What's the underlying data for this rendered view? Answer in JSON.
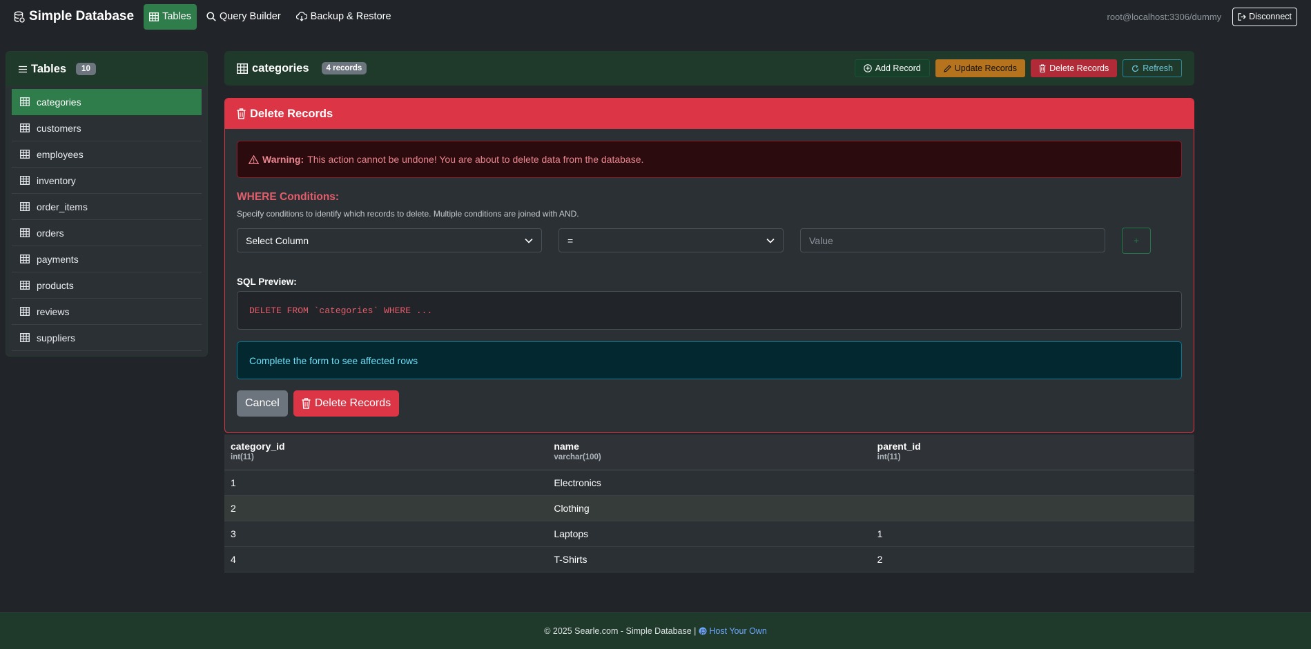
{
  "navbar": {
    "brand": "Simple Database",
    "links": [
      {
        "label": "Tables",
        "icon": "table-icon",
        "active": true
      },
      {
        "label": "Query Builder",
        "icon": "search-icon",
        "active": false
      },
      {
        "label": "Backup & Restore",
        "icon": "cloud-download-icon",
        "active": false
      }
    ],
    "connection": "root@localhost:3306/dummy",
    "disconnect_label": "Disconnect"
  },
  "sidebar": {
    "title": "Tables",
    "count": "10",
    "items": [
      {
        "label": "categories",
        "active": true
      },
      {
        "label": "customers",
        "active": false
      },
      {
        "label": "employees",
        "active": false
      },
      {
        "label": "inventory",
        "active": false
      },
      {
        "label": "order_items",
        "active": false
      },
      {
        "label": "orders",
        "active": false
      },
      {
        "label": "payments",
        "active": false
      },
      {
        "label": "products",
        "active": false
      },
      {
        "label": "reviews",
        "active": false
      },
      {
        "label": "suppliers",
        "active": false
      }
    ]
  },
  "table_header": {
    "name": "categories",
    "records": "4 records",
    "actions": {
      "add": "Add Record",
      "update": "Update Records",
      "delete": "Delete Records",
      "refresh": "Refresh"
    }
  },
  "delete_panel": {
    "title": "Delete Records",
    "warning_bold": "Warning:",
    "warning_text": "This action cannot be undone! You are about to delete data from the database.",
    "where_title": "WHERE Conditions:",
    "where_help": "Specify conditions to identify which records to delete. Multiple conditions are joined with AND.",
    "column_select": "Select Column",
    "operator_select": "=",
    "value_placeholder": "Value",
    "add_condition": "+",
    "sql_label": "SQL Preview:",
    "sql_preview": "DELETE FROM `categories` WHERE ...",
    "info_text": "Complete the form to see affected rows",
    "cancel_label": "Cancel",
    "confirm_label": "Delete Records"
  },
  "data_table": {
    "columns": [
      {
        "name": "category_id",
        "type": "int(11)"
      },
      {
        "name": "name",
        "type": "varchar(100)"
      },
      {
        "name": "parent_id",
        "type": "int(11)"
      }
    ],
    "rows": [
      [
        "1",
        "Electronics",
        ""
      ],
      [
        "2",
        "Clothing",
        ""
      ],
      [
        "3",
        "Laptops",
        "1"
      ],
      [
        "4",
        "T-Shirts",
        "2"
      ]
    ]
  },
  "footer": {
    "copyright": "© 2025 Searle.com - Simple Database |",
    "link": "Host Your Own"
  },
  "colors": {
    "accent_green": "#2e7d4a",
    "danger": "#dc3545",
    "warning": "#b5731d",
    "info": "#6edff6"
  }
}
